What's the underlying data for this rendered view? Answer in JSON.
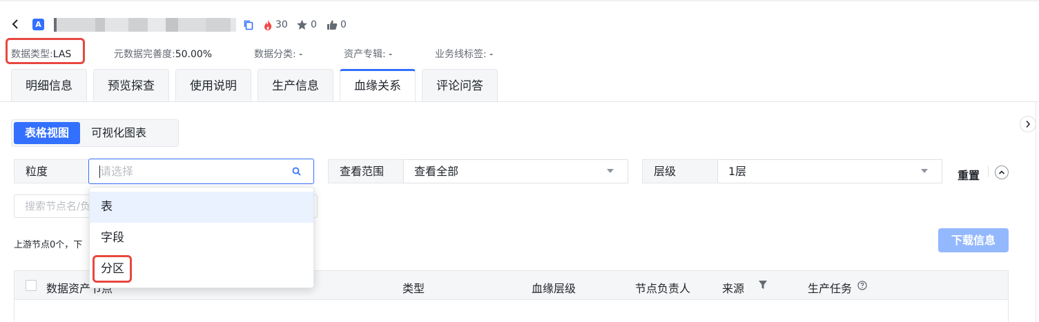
{
  "header": {
    "back_icon": "chevron-left-icon",
    "logo_letter": "A",
    "stats": {
      "hot": "30",
      "favorites": "0",
      "likes": "0"
    }
  },
  "meta": {
    "data_type_label": "数据类型:",
    "data_type_value": "LAS",
    "completeness_label": "元数据完善度:",
    "completeness_value": "50.00%",
    "category_label": "数据分类:",
    "category_value": "-",
    "album_label": "资产专辑:",
    "album_value": "-",
    "bizline_label": "业务线标签:",
    "bizline_value": "-"
  },
  "tabs": [
    "明细信息",
    "预览探查",
    "使用说明",
    "生产信息",
    "血缘关系",
    "评论问答"
  ],
  "active_tab": "血缘关系",
  "view_toggle": {
    "table": "表格视图",
    "chart": "可视化图表"
  },
  "filters": {
    "granularity_label": "粒度",
    "granularity_placeholder": "请选择",
    "scope_label": "查看范围",
    "scope_value": "查看全部",
    "level_label": "层级",
    "level_value": "1层",
    "reset": "重置",
    "search_placeholder": "搜索节点名/负"
  },
  "granularity_options": [
    "表",
    "字段",
    "分区"
  ],
  "summary": "上游节点0个，下",
  "download": "下载信息",
  "table": {
    "columns": [
      "数据资产节点",
      "类型",
      "血缘层级",
      "节点负责人",
      "来源",
      "生产任务"
    ]
  },
  "colors": {
    "accent": "#3370ff",
    "highlight": "#e8473f",
    "download_disabled": "#94b8fd"
  }
}
